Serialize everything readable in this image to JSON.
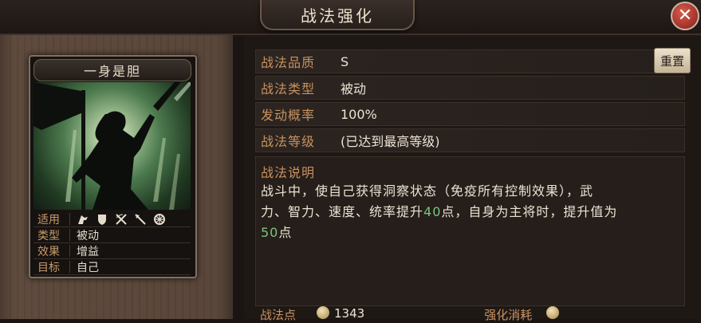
{
  "window": {
    "title": "战法强化",
    "close_icon": "close-icon"
  },
  "card": {
    "name": "一身是胆",
    "stats": [
      {
        "label": "适用",
        "icons": [
          "cavalry-icon",
          "shield-icon",
          "crossed-bows-icon",
          "spear-icon",
          "wheel-icon"
        ]
      },
      {
        "label": "类型",
        "value": "被动"
      },
      {
        "label": "效果",
        "value": "增益"
      },
      {
        "label": "目标",
        "value": "自己"
      }
    ]
  },
  "info": {
    "quality": {
      "label": "战法品质",
      "value": "S"
    },
    "type": {
      "label": "战法类型",
      "value": "被动"
    },
    "trigger_rate": {
      "label": "发动概率",
      "value": "100%"
    },
    "level": {
      "label": "战法等级",
      "value": "(已达到最高等级)"
    },
    "reset_label": "重置"
  },
  "description": {
    "title": "战法说明",
    "line1": "战斗中，使自己获得洞察状态（免疫所有控制效果），武",
    "line2_a": "力、智力、速度、统率提升",
    "line2_hl": "40",
    "line2_b": "点，自身为主将时，提升值为",
    "line3_hl": "50",
    "line3_b": "点"
  },
  "bottom": {
    "points_label": "战法点",
    "points_value": "1343",
    "cost_label": "强化消耗"
  },
  "colors": {
    "accent": "#c8925f",
    "highlight": "#7cc47c",
    "close": "#b2352b"
  }
}
